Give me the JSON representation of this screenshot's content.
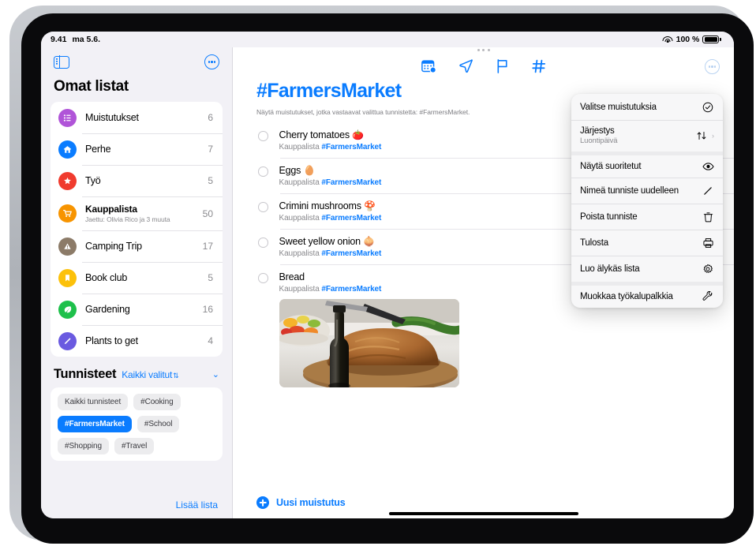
{
  "status_bar": {
    "time": "9.41",
    "date": "ma 5.6.",
    "wifi_icon": "wifi-icon",
    "battery_percent": "100 %",
    "battery_icon": "battery-full-icon"
  },
  "sidebar": {
    "toggle_icon": "sidebar-toggle-icon",
    "more_icon": "more-circle-icon",
    "title": "Omat listat",
    "lists": [
      {
        "name": "Muistutukset",
        "count": "6",
        "icon": "bulleted-list-icon",
        "color": "#b054d8",
        "subtitle": ""
      },
      {
        "name": "Perhe",
        "count": "7",
        "icon": "house-icon",
        "color": "#0a7cff",
        "subtitle": ""
      },
      {
        "name": "Työ",
        "count": "5",
        "icon": "star-icon",
        "color": "#f03b2e",
        "subtitle": ""
      },
      {
        "name": "Kauppalista",
        "count": "50",
        "icon": "shopping-cart-icon",
        "color": "#f79400",
        "subtitle": "Jaettu: Olivia Rico ja 3 muuta"
      },
      {
        "name": "Camping Trip",
        "count": "17",
        "icon": "tent-icon",
        "color": "#8c7b68",
        "subtitle": ""
      },
      {
        "name": "Book club",
        "count": "5",
        "icon": "bookmark-icon",
        "color": "#fcc10a",
        "subtitle": ""
      },
      {
        "name": "Gardening",
        "count": "16",
        "icon": "leaf-icon",
        "color": "#1ec04b",
        "subtitle": ""
      },
      {
        "name": "Plants to get",
        "count": "4",
        "icon": "pencil-icon",
        "color": "#6a5ae0",
        "subtitle": ""
      }
    ],
    "tags_section": {
      "title": "Tunnisteet",
      "filter_label": "Kaikki valitut",
      "stepper_icon": "up-down-stepper-icon",
      "collapse_icon": "chevron-down-icon",
      "tags": [
        {
          "label": "Kaikki tunnisteet",
          "selected": false
        },
        {
          "label": "#Cooking",
          "selected": false
        },
        {
          "label": "#FarmersMarket",
          "selected": true
        },
        {
          "label": "#School",
          "selected": false
        },
        {
          "label": "#Shopping",
          "selected": false
        },
        {
          "label": "#Travel",
          "selected": false
        }
      ]
    },
    "add_list_label": "Lisää lista"
  },
  "main": {
    "drag_handle_icon": "multitasking-handle-icon",
    "toolbar_icons": [
      {
        "name": "calendar-badge-icon"
      },
      {
        "name": "navigation-arrow-icon"
      },
      {
        "name": "flag-icon"
      },
      {
        "name": "hashtag-icon"
      }
    ],
    "more_icon": "more-circle-icon",
    "title": "#FarmersMarket",
    "subtitle": "Näytä muistutukset, jotka vastaavat valittua tunnistetta: #FarmersMarket.",
    "reminders": [
      {
        "title": "Cherry tomatoes",
        "emoji": "🍅",
        "list": "Kauppalista",
        "tag": "#FarmersMarket",
        "photo": false
      },
      {
        "title": "Eggs",
        "emoji": "🥚",
        "list": "Kauppalista",
        "tag": "#FarmersMarket",
        "photo": false
      },
      {
        "title": "Crimini mushrooms",
        "emoji": "🍄",
        "list": "Kauppalista",
        "tag": "#FarmersMarket",
        "photo": false
      },
      {
        "title": "Sweet yellow onion",
        "emoji": "🧅",
        "list": "Kauppalista",
        "tag": "#FarmersMarket",
        "photo": false
      },
      {
        "title": "Bread",
        "emoji": "",
        "list": "Kauppalista",
        "tag": "#FarmersMarket",
        "photo": true,
        "photo_alt": "bread-loaf-photo"
      }
    ],
    "new_reminder_label": "Uusi muistutus",
    "add_icon": "plus-circle-icon"
  },
  "context_menu": {
    "items": [
      {
        "label": "Valitse muistutuksia",
        "sub": "",
        "icon": "checkmark-circle-icon",
        "chevron": false,
        "group_start": false
      },
      {
        "label": "Järjestys",
        "sub": "Luontipäivä",
        "icon": "sort-arrows-icon",
        "chevron": true,
        "group_start": false
      },
      {
        "label": "Näytä suoritetut",
        "sub": "",
        "icon": "eye-icon",
        "chevron": false,
        "group_start": true
      },
      {
        "label": "Nimeä tunniste uudelleen",
        "sub": "",
        "icon": "pencil-icon",
        "chevron": false,
        "group_start": false
      },
      {
        "label": "Poista tunniste",
        "sub": "",
        "icon": "trash-icon",
        "chevron": false,
        "group_start": false
      },
      {
        "label": "Tulosta",
        "sub": "",
        "icon": "printer-icon",
        "chevron": false,
        "group_start": false
      },
      {
        "label": "Luo älykäs lista",
        "sub": "",
        "icon": "gear-icon",
        "chevron": false,
        "group_start": false
      },
      {
        "label": "Muokkaa työkalupalkkia",
        "sub": "",
        "icon": "wrench-icon",
        "chevron": false,
        "group_start": true
      }
    ]
  },
  "colors": {
    "accent": "#0a7cff",
    "sidebar_bg": "#f2f1f6",
    "card_bg": "#ffffff",
    "menu_bg": "#f7f7f8"
  }
}
